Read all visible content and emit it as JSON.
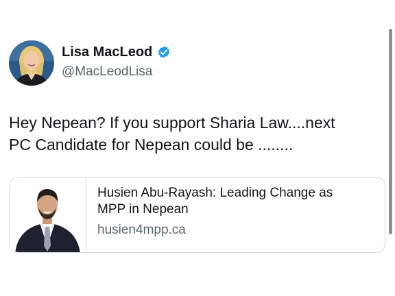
{
  "tweet": {
    "author": {
      "display_name": "Lisa MacLeod",
      "handle": "@MacLeodLisa",
      "verified": true,
      "avatar_icon": "profile-photo"
    },
    "text_lines": [
      "Hey Nepean?  If you support Sharia Law....next",
      "PC Candidate for Nepean could be ........"
    ],
    "link_card": {
      "title_lines": [
        "Husien Abu-Rayash: Leading Change as",
        "MPP in Nepean"
      ],
      "domain": "husien4mpp.ca",
      "thumbnail_icon": "candidate-photo"
    }
  },
  "colors": {
    "verified_blue": "#1d9bf0",
    "secondary_text": "#536471",
    "primary_text": "#0f1419",
    "card_border": "#cfd9de",
    "scrollbar": "#8f8f8f"
  }
}
